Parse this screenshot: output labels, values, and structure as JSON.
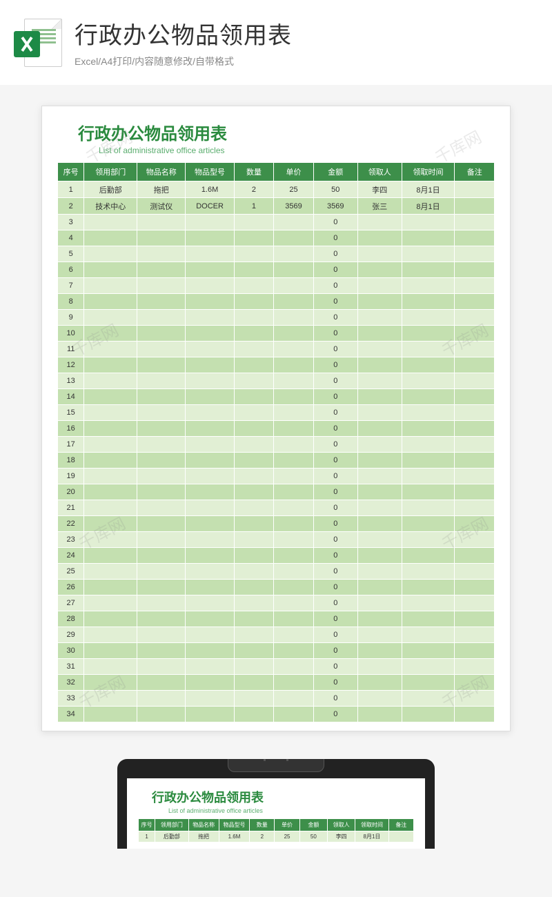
{
  "header": {
    "title": "行政办公物品领用表",
    "subtitle": "Excel/A4打印/内容随意修改/自带格式"
  },
  "document": {
    "title": "行政办公物品领用表",
    "subtitle": "List of administrative office articles"
  },
  "watermark_text": "千库网",
  "columns": [
    "序号",
    "领用部门",
    "物品名称",
    "物品型号",
    "数量",
    "单价",
    "金额",
    "领取人",
    "领取时间",
    "备注"
  ],
  "rows": [
    {
      "seq": "1",
      "dept": "后勤部",
      "name": "拖把",
      "model": "1.6M",
      "qty": "2",
      "price": "25",
      "amount": "50",
      "person": "李四",
      "time": "8月1日",
      "remark": ""
    },
    {
      "seq": "2",
      "dept": "技术中心",
      "name": "测试仪",
      "model": "DOCER",
      "qty": "1",
      "price": "3569",
      "amount": "3569",
      "person": "张三",
      "time": "8月1日",
      "remark": ""
    },
    {
      "seq": "3",
      "dept": "",
      "name": "",
      "model": "",
      "qty": "",
      "price": "",
      "amount": "0",
      "person": "",
      "time": "",
      "remark": ""
    },
    {
      "seq": "4",
      "dept": "",
      "name": "",
      "model": "",
      "qty": "",
      "price": "",
      "amount": "0",
      "person": "",
      "time": "",
      "remark": ""
    },
    {
      "seq": "5",
      "dept": "",
      "name": "",
      "model": "",
      "qty": "",
      "price": "",
      "amount": "0",
      "person": "",
      "time": "",
      "remark": ""
    },
    {
      "seq": "6",
      "dept": "",
      "name": "",
      "model": "",
      "qty": "",
      "price": "",
      "amount": "0",
      "person": "",
      "time": "",
      "remark": ""
    },
    {
      "seq": "7",
      "dept": "",
      "name": "",
      "model": "",
      "qty": "",
      "price": "",
      "amount": "0",
      "person": "",
      "time": "",
      "remark": ""
    },
    {
      "seq": "8",
      "dept": "",
      "name": "",
      "model": "",
      "qty": "",
      "price": "",
      "amount": "0",
      "person": "",
      "time": "",
      "remark": ""
    },
    {
      "seq": "9",
      "dept": "",
      "name": "",
      "model": "",
      "qty": "",
      "price": "",
      "amount": "0",
      "person": "",
      "time": "",
      "remark": ""
    },
    {
      "seq": "10",
      "dept": "",
      "name": "",
      "model": "",
      "qty": "",
      "price": "",
      "amount": "0",
      "person": "",
      "time": "",
      "remark": ""
    },
    {
      "seq": "11",
      "dept": "",
      "name": "",
      "model": "",
      "qty": "",
      "price": "",
      "amount": "0",
      "person": "",
      "time": "",
      "remark": ""
    },
    {
      "seq": "12",
      "dept": "",
      "name": "",
      "model": "",
      "qty": "",
      "price": "",
      "amount": "0",
      "person": "",
      "time": "",
      "remark": ""
    },
    {
      "seq": "13",
      "dept": "",
      "name": "",
      "model": "",
      "qty": "",
      "price": "",
      "amount": "0",
      "person": "",
      "time": "",
      "remark": ""
    },
    {
      "seq": "14",
      "dept": "",
      "name": "",
      "model": "",
      "qty": "",
      "price": "",
      "amount": "0",
      "person": "",
      "time": "",
      "remark": ""
    },
    {
      "seq": "15",
      "dept": "",
      "name": "",
      "model": "",
      "qty": "",
      "price": "",
      "amount": "0",
      "person": "",
      "time": "",
      "remark": ""
    },
    {
      "seq": "16",
      "dept": "",
      "name": "",
      "model": "",
      "qty": "",
      "price": "",
      "amount": "0",
      "person": "",
      "time": "",
      "remark": ""
    },
    {
      "seq": "17",
      "dept": "",
      "name": "",
      "model": "",
      "qty": "",
      "price": "",
      "amount": "0",
      "person": "",
      "time": "",
      "remark": ""
    },
    {
      "seq": "18",
      "dept": "",
      "name": "",
      "model": "",
      "qty": "",
      "price": "",
      "amount": "0",
      "person": "",
      "time": "",
      "remark": ""
    },
    {
      "seq": "19",
      "dept": "",
      "name": "",
      "model": "",
      "qty": "",
      "price": "",
      "amount": "0",
      "person": "",
      "time": "",
      "remark": ""
    },
    {
      "seq": "20",
      "dept": "",
      "name": "",
      "model": "",
      "qty": "",
      "price": "",
      "amount": "0",
      "person": "",
      "time": "",
      "remark": ""
    },
    {
      "seq": "21",
      "dept": "",
      "name": "",
      "model": "",
      "qty": "",
      "price": "",
      "amount": "0",
      "person": "",
      "time": "",
      "remark": ""
    },
    {
      "seq": "22",
      "dept": "",
      "name": "",
      "model": "",
      "qty": "",
      "price": "",
      "amount": "0",
      "person": "",
      "time": "",
      "remark": ""
    },
    {
      "seq": "23",
      "dept": "",
      "name": "",
      "model": "",
      "qty": "",
      "price": "",
      "amount": "0",
      "person": "",
      "time": "",
      "remark": ""
    },
    {
      "seq": "24",
      "dept": "",
      "name": "",
      "model": "",
      "qty": "",
      "price": "",
      "amount": "0",
      "person": "",
      "time": "",
      "remark": ""
    },
    {
      "seq": "25",
      "dept": "",
      "name": "",
      "model": "",
      "qty": "",
      "price": "",
      "amount": "0",
      "person": "",
      "time": "",
      "remark": ""
    },
    {
      "seq": "26",
      "dept": "",
      "name": "",
      "model": "",
      "qty": "",
      "price": "",
      "amount": "0",
      "person": "",
      "time": "",
      "remark": ""
    },
    {
      "seq": "27",
      "dept": "",
      "name": "",
      "model": "",
      "qty": "",
      "price": "",
      "amount": "0",
      "person": "",
      "time": "",
      "remark": ""
    },
    {
      "seq": "28",
      "dept": "",
      "name": "",
      "model": "",
      "qty": "",
      "price": "",
      "amount": "0",
      "person": "",
      "time": "",
      "remark": ""
    },
    {
      "seq": "29",
      "dept": "",
      "name": "",
      "model": "",
      "qty": "",
      "price": "",
      "amount": "0",
      "person": "",
      "time": "",
      "remark": ""
    },
    {
      "seq": "30",
      "dept": "",
      "name": "",
      "model": "",
      "qty": "",
      "price": "",
      "amount": "0",
      "person": "",
      "time": "",
      "remark": ""
    },
    {
      "seq": "31",
      "dept": "",
      "name": "",
      "model": "",
      "qty": "",
      "price": "",
      "amount": "0",
      "person": "",
      "time": "",
      "remark": ""
    },
    {
      "seq": "32",
      "dept": "",
      "name": "",
      "model": "",
      "qty": "",
      "price": "",
      "amount": "0",
      "person": "",
      "time": "",
      "remark": ""
    },
    {
      "seq": "33",
      "dept": "",
      "name": "",
      "model": "",
      "qty": "",
      "price": "",
      "amount": "0",
      "person": "",
      "time": "",
      "remark": ""
    },
    {
      "seq": "34",
      "dept": "",
      "name": "",
      "model": "",
      "qty": "",
      "price": "",
      "amount": "0",
      "person": "",
      "time": "",
      "remark": ""
    }
  ],
  "clipboard_rows": [
    {
      "seq": "1",
      "dept": "后勤部",
      "name": "拖把",
      "model": "1.6M",
      "qty": "2",
      "price": "25",
      "amount": "50",
      "person": "李四",
      "time": "8月1日",
      "remark": ""
    }
  ]
}
